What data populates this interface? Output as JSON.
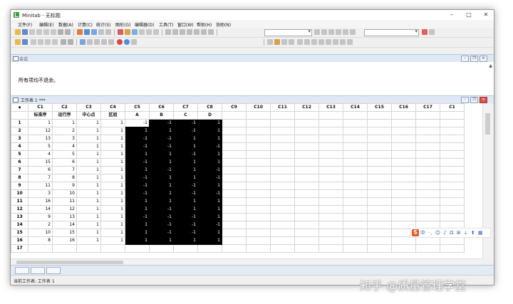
{
  "window": {
    "title": "Minitab - 无标题"
  },
  "menu": [
    "文件(F)",
    "编辑(E)",
    "数据(A)",
    "计算(C)",
    "统计(S)",
    "图形(G)",
    "编辑器(D)",
    "工具(T)",
    "窗口(W)",
    "帮助(H)",
    "协助(N)"
  ],
  "session": {
    "pane_title": "会话",
    "message": "所有项均不退余。"
  },
  "worksheet": {
    "title": "工作表 1 ***",
    "columns": [
      "C1",
      "C2",
      "C3",
      "C4",
      "C5",
      "C6",
      "C7",
      "C8",
      "C9",
      "C10",
      "C11",
      "C12",
      "C13",
      "C14",
      "C15",
      "C16",
      "C17",
      "C1"
    ],
    "column_names": [
      "标准序",
      "运行序",
      "中心点",
      "区组",
      "A",
      "B",
      "C",
      "D",
      "",
      "",
      "",
      "",
      "",
      "",
      "",
      "",
      "",
      ""
    ],
    "rows": [
      [
        "1",
        "1",
        "1",
        "1",
        "-1",
        "-1",
        "-1",
        "1"
      ],
      [
        "12",
        "2",
        "1",
        "1",
        "1",
        "1",
        "-1",
        "1"
      ],
      [
        "13",
        "3",
        "1",
        "1",
        "-1",
        "-1",
        "1",
        "1"
      ],
      [
        "5",
        "4",
        "1",
        "1",
        "-1",
        "-1",
        "1",
        "-1"
      ],
      [
        "4",
        "5",
        "1",
        "1",
        "1",
        "1",
        "-1",
        "1"
      ],
      [
        "15",
        "6",
        "1",
        "1",
        "-1",
        "1",
        "1",
        "1"
      ],
      [
        "6",
        "7",
        "1",
        "1",
        "1",
        "-1",
        "1",
        "-1"
      ],
      [
        "7",
        "8",
        "1",
        "1",
        "-1",
        "1",
        "1",
        "-1"
      ],
      [
        "11",
        "9",
        "1",
        "1",
        "-1",
        "1",
        "-1",
        "1"
      ],
      [
        "3",
        "10",
        "1",
        "1",
        "-1",
        "1",
        "-1",
        "-1"
      ],
      [
        "16",
        "11",
        "1",
        "1",
        "1",
        "1",
        "1",
        "1"
      ],
      [
        "14",
        "12",
        "1",
        "1",
        "1",
        "-1",
        "1",
        "1"
      ],
      [
        "9",
        "13",
        "1",
        "1",
        "-1",
        "-1",
        "-1",
        "1"
      ],
      [
        "2",
        "14",
        "1",
        "1",
        "1",
        "-1",
        "-1",
        "-1"
      ],
      [
        "10",
        "15",
        "1",
        "1",
        "1",
        "-1",
        "-1",
        "1"
      ],
      [
        "8",
        "16",
        "1",
        "1",
        "1",
        "1",
        "1",
        "1"
      ],
      [
        "",
        "",
        "",
        "",
        "",
        "",
        "",
        ""
      ]
    ],
    "row_numbers": [
      "1",
      "2",
      "3",
      "4",
      "5",
      "6",
      "7",
      "8",
      "9",
      "10",
      "11",
      "12",
      "13",
      "14",
      "15",
      "16",
      "17"
    ]
  },
  "status": {
    "text": "当前工作表: 工作表 1"
  },
  "ime": {
    "label": "中 ·, ☺ ♪ Ω ⊞ ⇣ ⬆ ▦"
  },
  "watermark": "知乎 @质量管理学堂",
  "colors": {
    "selected_fill": "#000000",
    "pane_bar": "#dfe8f5",
    "app_icon": "#3a9e3a",
    "close_button": "#d9534f",
    "ime_logo": "#e8541e"
  }
}
